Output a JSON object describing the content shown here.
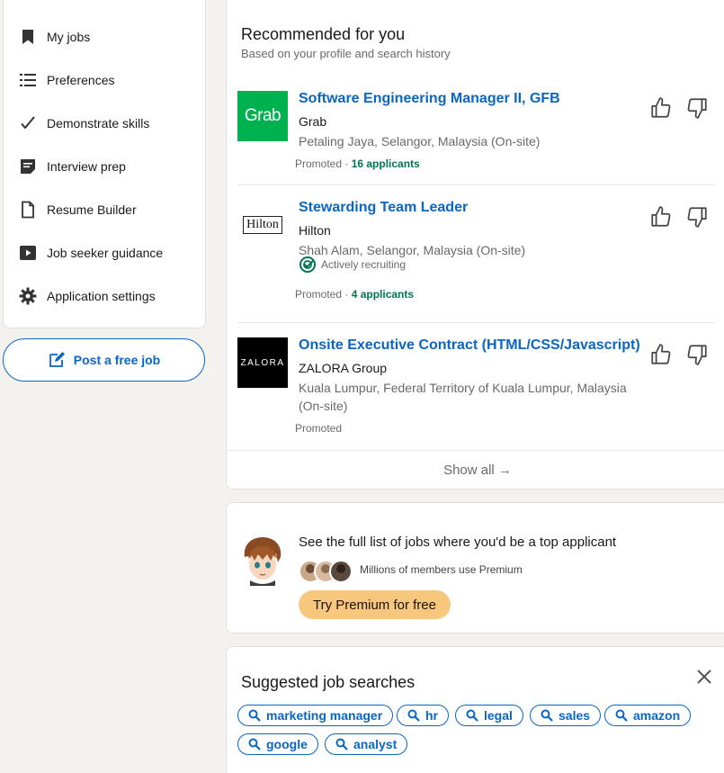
{
  "sidebar": {
    "items": [
      {
        "label": "My jobs",
        "icon": "bookmark-icon"
      },
      {
        "label": "Preferences",
        "icon": "list-icon"
      },
      {
        "label": "Demonstrate skills",
        "icon": "checkmark-icon"
      },
      {
        "label": "Interview prep",
        "icon": "notes-icon"
      },
      {
        "label": "Resume Builder",
        "icon": "document-icon"
      },
      {
        "label": "Job seeker guidance",
        "icon": "video-icon"
      },
      {
        "label": "Application settings",
        "icon": "gear-icon"
      }
    ],
    "post_job_label": "Post a free job"
  },
  "recommended": {
    "title": "Recommended for you",
    "subtitle": "Based on your profile and search history",
    "jobs": [
      {
        "title": "Software Engineering Manager II, GFB",
        "company": "Grab",
        "location": "Petaling Jaya, Selangor, Malaysia (On-site)",
        "logo_text": "Grab",
        "promoted": "Promoted",
        "separator": " · ",
        "applicants": "16 applicants"
      },
      {
        "title": "Stewarding Team Leader",
        "company": "Hilton",
        "location": "Shah Alam, Selangor, Malaysia (On-site)",
        "logo_text": "Hilton",
        "recruiting": "Actively recruiting",
        "promoted": "Promoted",
        "separator": " · ",
        "applicants": "4 applicants"
      },
      {
        "title": "Onsite Executive Contract (HTML/CSS/Javascript)",
        "company": "ZALORA Group",
        "location": "Kuala Lumpur, Federal Territory of Kuala Lumpur, Malaysia (On-site)",
        "logo_text": "ZALORA",
        "promoted": "Promoted"
      }
    ],
    "show_all": "Show all →"
  },
  "premium": {
    "text": "See the full list of jobs where you'd be a top applicant",
    "members": "Millions of members use Premium",
    "button": "Try Premium for free"
  },
  "suggested": {
    "title": "Suggested job searches",
    "chips": [
      "marketing manager",
      "hr",
      "legal",
      "sales",
      "amazon",
      "google",
      "analyst"
    ]
  },
  "colors": {
    "accent": "#0a66c2",
    "applicants_green": "#01754f",
    "premium_gold": "#f8c77e",
    "grab_green": "#00b14f"
  }
}
